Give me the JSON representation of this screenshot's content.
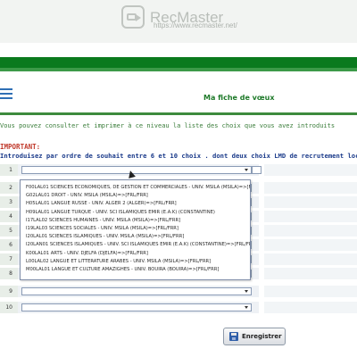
{
  "watermark": {
    "title": "RecMaster",
    "url": "https://www.recmaster.net/"
  },
  "header": {
    "title": "Ma fiche de vœux"
  },
  "info_text": "Vous pouvez consulter et imprimer à ce niveau la liste des choix que vous avez introduits",
  "important_label": "IMPORTANT:",
  "instruction_text": "Introduisez par ordre de souhait entre 6 et 10 choix . dont deux choix LMD de recrutement local",
  "rows": [
    {
      "num": "1",
      "value": ""
    },
    {
      "num": "2",
      "value": ""
    },
    {
      "num": "3",
      "value": ""
    },
    {
      "num": "4",
      "value": ""
    },
    {
      "num": "5",
      "value": ""
    },
    {
      "num": "6",
      "value": ""
    },
    {
      "num": "7",
      "value": ""
    },
    {
      "num": "8",
      "value": ""
    },
    {
      "num": "9",
      "value": ""
    },
    {
      "num": "10",
      "value": ""
    }
  ],
  "dropdown_options": [
    "F00LAL01 SCIENCES ECONOMIQUES, DE GESTION ET COMMERCIALES - UNIV. MSILA (MSILA)=>[FRL/FRR]",
    "G02LAL01 DROIT - UNIV. MSILA (MSILA)=>[FRL/FRR]",
    "H05LAL01 LANGUE RUSSE - UNIV. ALGER 2 (ALGER)=>[FRL/FRR]",
    "H09LAL01 LANGUE TURQUE - UNIV. SCI ISLAMIQUES EMIR (E.A.K) (CONSTANTINE)",
    "I17LAL02 SCIENCES HUMAINES - UNIV. MSILA (MSILA)=>[FRL/FRR]",
    "I19LAL03 SCIENCES SOCIALES - UNIV. MSILA (MSILA)=>[FRL/FRR]",
    "I20LAL01 SCIENCES ISLAMIQUES - UNIV. MSILA (MSILA)=>[FRL/FRR]",
    "I20LAN01 SCIENCES ISLAMIQUES - UNIV. SCI ISLAMIQUES EMIR (E.A.K) (CONSTANTINE)=>[FRL/FRR]",
    "K00LAL01 ARTS - UNIV. DJELFA (DJELFA)=>[FRL/FRR]",
    "L00LAL02 LANGUE ET LITTERATURE ARABES - UNIV. MSILA (MSILA)=>[FRL/FRR]",
    "M00LAL01 LANGUE ET CULTURE AMAZIGHES - UNIV. BOUIRA (BOUIRA)=>[FRL/FRR]"
  ],
  "save_button": {
    "label": "Enregistrer"
  },
  "colors": {
    "green_band": "#0a7a1e",
    "title_green": "#1f7a2a",
    "important_red": "#c0392b",
    "instruction_blue": "#1a3a8a"
  }
}
